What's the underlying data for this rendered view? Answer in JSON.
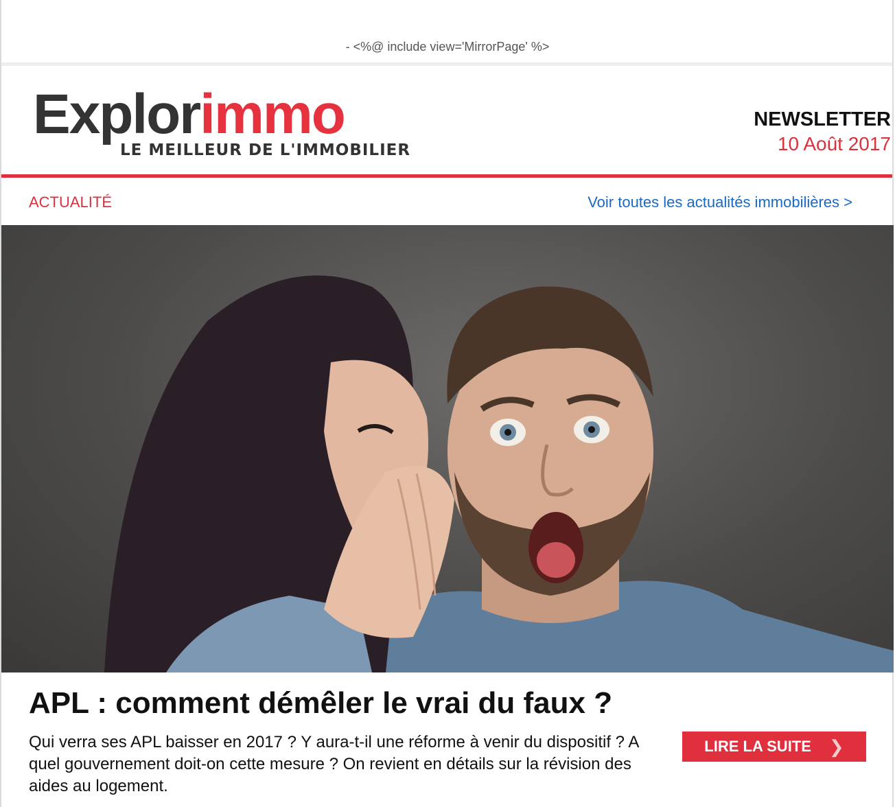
{
  "preheader": {
    "mirror_text": "- <%@ include view='MirrorPage' %>"
  },
  "header": {
    "logo_word_dark": "Explor",
    "logo_word_red": "immo",
    "logo_tagline": "LE MEILLEUR DE L'IMMOBILIER",
    "newsletter_label": "NEWSLETTER",
    "newsletter_date": "10 Août 2017"
  },
  "section": {
    "label": "ACTUALITÉ",
    "all_link": "Voir toutes les actualités immobilières >"
  },
  "article": {
    "hero_image": "man-and-woman-whispering-photo",
    "title": "APL : comment démêler le vrai du faux ?",
    "summary": "Qui verra ses APL baisser en 2017 ? Y aura-t-il une réforme à venir du dispositif ? A quel gouvernement doit-on cette mesure ? On revient en détails sur la révision des aides au logement.",
    "cta_label": "LIRE LA SUITE",
    "cta_icon": "chevron-right-icon"
  },
  "colors": {
    "brand_red": "#e02f3d",
    "link_blue": "#1a69c4",
    "text_dark": "#111111"
  }
}
